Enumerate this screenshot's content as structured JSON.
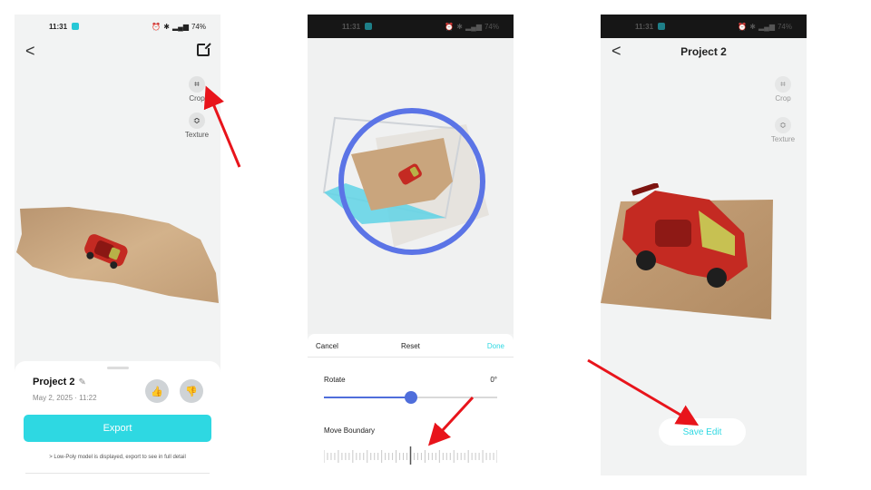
{
  "screen1": {
    "status": {
      "time": "11:31",
      "battery": "74%"
    },
    "back_label": "<",
    "tools": [
      {
        "label": "Crop",
        "icon": "crop-icon",
        "glyph": "⌗"
      },
      {
        "label": "Texture",
        "icon": "texture-icon",
        "glyph": "≎"
      }
    ],
    "sheet": {
      "project_title": "Project 2",
      "edit_glyph": "✎",
      "date": "May 2, 2025 · 11:22",
      "like_glyph": "👍",
      "dislike_glyph": "👎",
      "export_label": "Export",
      "lowpoly_chevron": ">",
      "lowpoly_note": "Low-Poly model is displayed, export to see in full detail"
    }
  },
  "screen2": {
    "status": {
      "time": "11:31",
      "battery": "74%"
    },
    "actions": {
      "cancel": "Cancel",
      "reset": "Reset",
      "done": "Done"
    },
    "rotate": {
      "label": "Rotate",
      "value": "0°",
      "slider_fraction": 0.5
    },
    "boundary": {
      "label": "Move Boundary"
    }
  },
  "screen3": {
    "status": {
      "time": "11:31",
      "battery": "74%"
    },
    "back_label": "<",
    "title": "Project 2",
    "tools": [
      {
        "label": "Crop",
        "icon": "crop-icon",
        "glyph": "⌗"
      },
      {
        "label": "Texture",
        "icon": "texture-icon",
        "glyph": "≎"
      }
    ],
    "save_label": "Save Edit"
  },
  "colors": {
    "accent": "#2ed8e2",
    "arrow": "#e8141b",
    "rotate_ring": "#5b74e6",
    "slider": "#4f6edb",
    "car": "#c42a22",
    "wood": "#c9a57d"
  }
}
